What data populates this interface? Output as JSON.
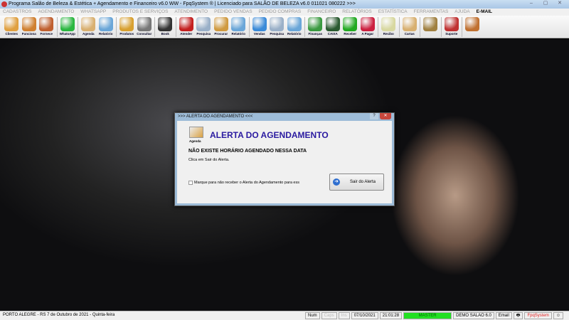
{
  "window": {
    "title": "Programa Salão de Beleza & Estética + Agendamento e Financeiro v6.0 WW - FpqSystem ® | Licenciado para  SALÃO DE BELEZA v6.0 011021 080222 >>>",
    "min": "–",
    "max": "▢",
    "close": "✕"
  },
  "menu": [
    "CADASTROS",
    "AGENDAMENTO",
    "WHATSAPP",
    "PRODUTOS E SERVIÇOS",
    "ATENDIMENTO",
    "PEDIDO VENDAS",
    "PEDIDO COMPRAS",
    "FINANCEIRO",
    "RELATÓRIOS",
    "ESTATÍSTICA",
    "FERRAMENTAS",
    "AJUDA"
  ],
  "menu_email": "E-MAIL",
  "toolbar": [
    [
      {
        "label": "Clientes",
        "icon": "clients-icon",
        "color": "#e0a040"
      },
      {
        "label": "Funciona",
        "icon": "employees-icon",
        "color": "#d08030"
      },
      {
        "label": "Fornece",
        "icon": "suppliers-icon",
        "color": "#c06030"
      }
    ],
    [
      {
        "label": "WhatsApp",
        "icon": "whatsapp-icon",
        "color": "#2bb741"
      }
    ],
    [
      {
        "label": "Agenda",
        "icon": "agenda-icon",
        "color": "#d9b070"
      },
      {
        "label": "Relatório",
        "icon": "report-icon",
        "color": "#6aa6d8"
      }
    ],
    [
      {
        "label": "Produtos",
        "icon": "products-icon",
        "color": "#d8a030"
      },
      {
        "label": "Consultar",
        "icon": "barcode-icon",
        "color": "#777777"
      }
    ],
    [
      {
        "label": "Book",
        "icon": "camera-icon",
        "color": "#333333"
      }
    ],
    [
      {
        "label": "Atender",
        "icon": "attend-icon",
        "color": "#c42020"
      },
      {
        "label": "Pesquisa",
        "icon": "search-icon",
        "color": "#9ab0c8"
      },
      {
        "label": "Procurar",
        "icon": "folder-icon",
        "color": "#d09a40"
      },
      {
        "label": "Relatório",
        "icon": "report-icon",
        "color": "#6aa6d8"
      }
    ],
    [
      {
        "label": "Vendas",
        "icon": "monitor-icon",
        "color": "#3a8ad8"
      },
      {
        "label": "Pesquisa",
        "icon": "search-icon",
        "color": "#9ab0c8"
      },
      {
        "label": "Relatório",
        "icon": "report-icon",
        "color": "#6aa6d8"
      }
    ],
    [
      {
        "label": "Finanças",
        "icon": "finance-icon",
        "color": "#3a9a40"
      },
      {
        "label": "CAIXA",
        "icon": "cashbook-icon",
        "color": "#2a5a30"
      },
      {
        "label": "Receber",
        "icon": "receive-dollar-icon",
        "color": "#22aa22"
      },
      {
        "label": "A Pagar",
        "icon": "pay-dollar-icon",
        "color": "#cc2040"
      }
    ],
    [
      {
        "label": "Recibo",
        "icon": "receipt-icon",
        "color": "#d8d8a0"
      }
    ],
    [
      {
        "label": "Cartas",
        "icon": "letters-icon",
        "color": "#d8b070"
      }
    ],
    [
      {
        "label": "",
        "icon": "coin-icon",
        "color": "#a08040"
      }
    ],
    [
      {
        "label": "Suporte",
        "icon": "support-icon",
        "color": "#c03030"
      }
    ],
    [
      {
        "label": "",
        "icon": "exit-door-icon",
        "color": "#c07030"
      }
    ]
  ],
  "dialog": {
    "title": ">>> ALERTA DO AGENDAMENTO <<<",
    "help": "?",
    "close": "✕",
    "icon_label": "Agenda",
    "heading": "ALERTA DO AGENDAMENTO",
    "message": "NÃO EXISTE HORÁRIO AGENDADO NESSA DATA",
    "sub": "Clica em Sair do Alerta.",
    "checkbox": "Marque para não receber o Alerta do Agendamento para ess",
    "checked": false,
    "button": "Sair do Alerta"
  },
  "status": {
    "location": "PORTO ALEGRE - RS  7 de Outubro de 2021 - Quinta-feira",
    "num": "Num",
    "caps": "Caps",
    "ins": "Ins",
    "date": "07/10/2021",
    "time": "21:01:28",
    "user": "MASTER",
    "db": "DEMO SALAO 6.0",
    "email": "Email",
    "brand": "FpqSystem",
    "accent_green": "#22e022"
  }
}
